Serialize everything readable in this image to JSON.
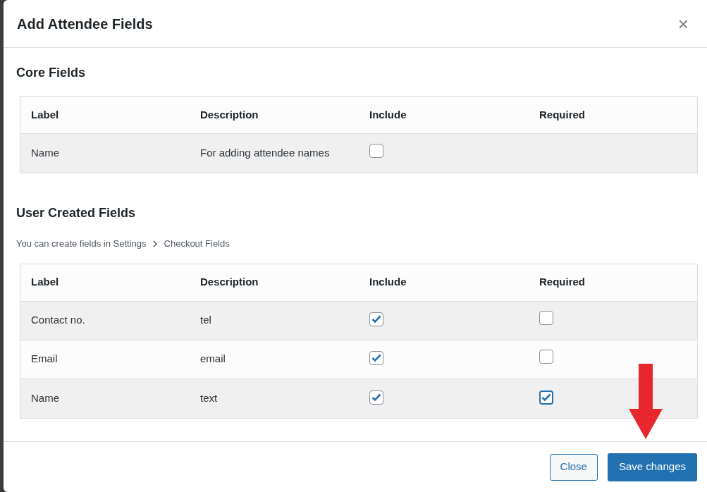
{
  "dialog": {
    "title": "Add Attendee Fields",
    "close_icon": "×"
  },
  "core_section": {
    "heading": "Core Fields",
    "columns": [
      "Label",
      "Description",
      "Include",
      "Required"
    ],
    "rows": [
      {
        "label": "Name",
        "description": "For adding attendee names",
        "include": {
          "checked": false
        }
      }
    ]
  },
  "user_section": {
    "heading": "User Created Fields",
    "hint": "You can create fields in Settings",
    "hint_link": "Checkout Fields",
    "columns": [
      "Label",
      "Description",
      "Include",
      "Required"
    ],
    "rows": [
      {
        "label": "Contact no.",
        "description": "tel",
        "include": {
          "checked": true
        },
        "required": {
          "checked": false,
          "focused": false
        }
      },
      {
        "label": "Email",
        "description": "email",
        "include": {
          "checked": true
        },
        "required": {
          "checked": false,
          "focused": false
        }
      },
      {
        "label": "Name",
        "description": "text",
        "include": {
          "checked": true
        },
        "required": {
          "checked": true,
          "focused": true
        }
      }
    ]
  },
  "footer": {
    "buttons": [
      {
        "label": "Close",
        "kind": "secondary"
      },
      {
        "label": "Save changes",
        "kind": "primary"
      }
    ]
  }
}
